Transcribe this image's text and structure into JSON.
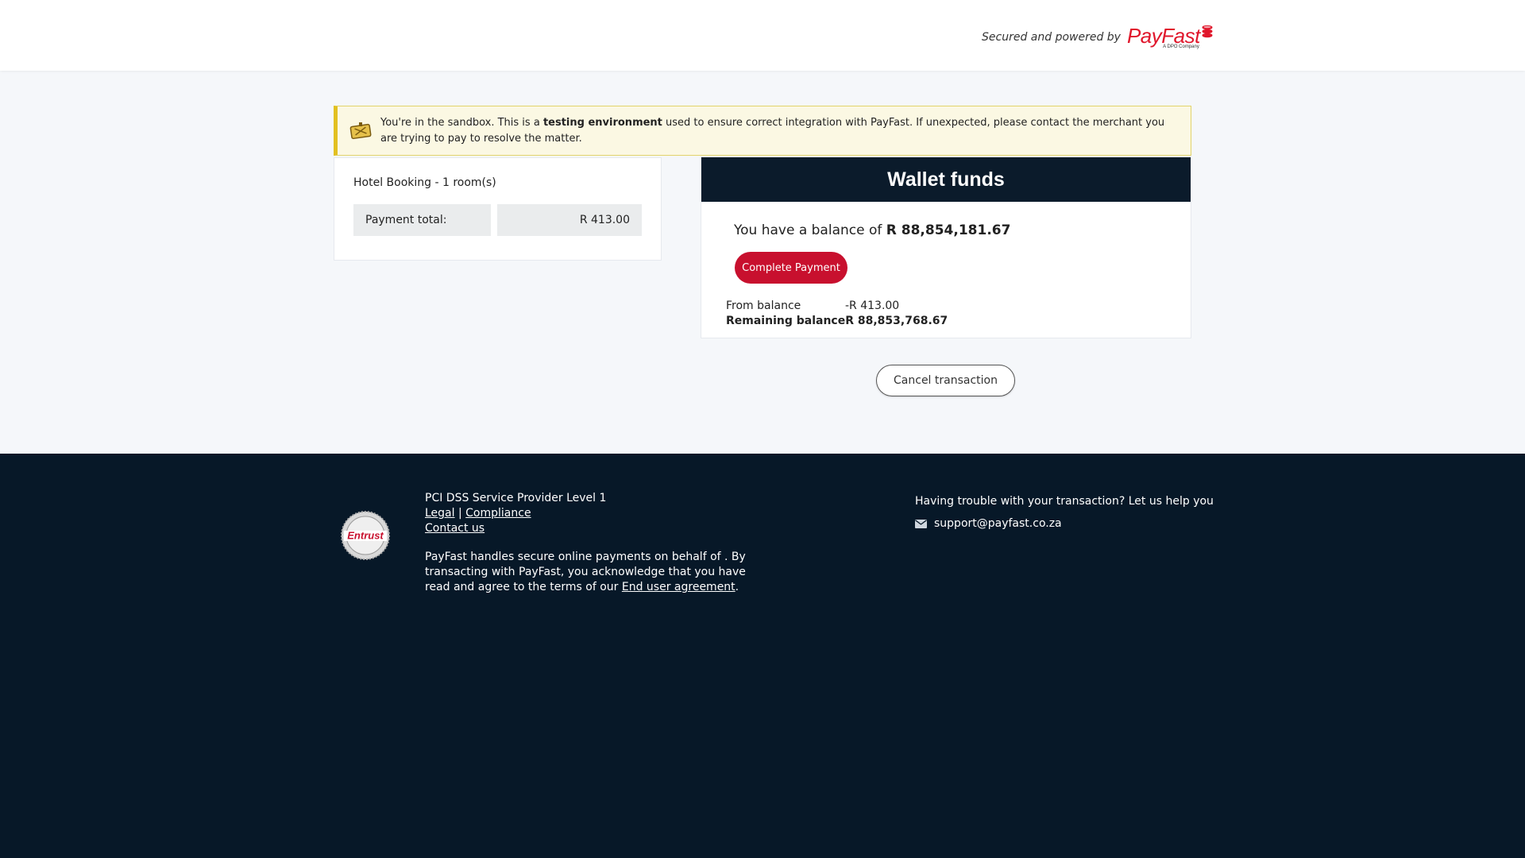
{
  "header": {
    "powered_text": "Secured and powered by",
    "logo_word": "PayFast",
    "logo_sub": "A DPO Company"
  },
  "sandbox": {
    "text_before": "You're in the sandbox. This is a ",
    "text_bold": "testing environment",
    "text_after": " used to ensure correct integration with PayFast. If unexpected, please contact the merchant you are trying to pay to resolve the matter."
  },
  "order": {
    "title": "Hotel Booking - 1 room(s)",
    "total_label": "Payment total:",
    "total_value": "R 413.00"
  },
  "wallet": {
    "heading": "Wallet funds",
    "balance_prefix": "You have a balance of ",
    "balance_amount": "R 88,854,181.67",
    "complete_label": "Complete Payment",
    "from_label": "From balance",
    "from_value": "-R 413.00",
    "remaining_label": "Remaining balance",
    "remaining_value": "R 88,853,768.67"
  },
  "cancel_label": "Cancel transaction",
  "footer": {
    "seal_text": "Entrust",
    "pci": "PCI DSS Service Provider Level 1",
    "legal": "Legal",
    "separator": "|",
    "compliance": "Compliance",
    "contact": "Contact us",
    "para_before": "PayFast handles secure online payments on behalf of . By transacting with PayFast, you acknowledge that you have read and agree to the terms of our ",
    "para_link": "End user agreement",
    "para_after": ".",
    "help": "Having trouble with your transaction? Let us help you",
    "support_email": "support@payfast.co.za"
  },
  "colors": {
    "brand_red": "#c8102e",
    "navy": "#0b1b2b",
    "footer_bg": "#071828"
  },
  "icons": [
    "payfast-coins-icon",
    "sandbox-sign-icon",
    "entrust-seal-icon",
    "mail-icon"
  ]
}
